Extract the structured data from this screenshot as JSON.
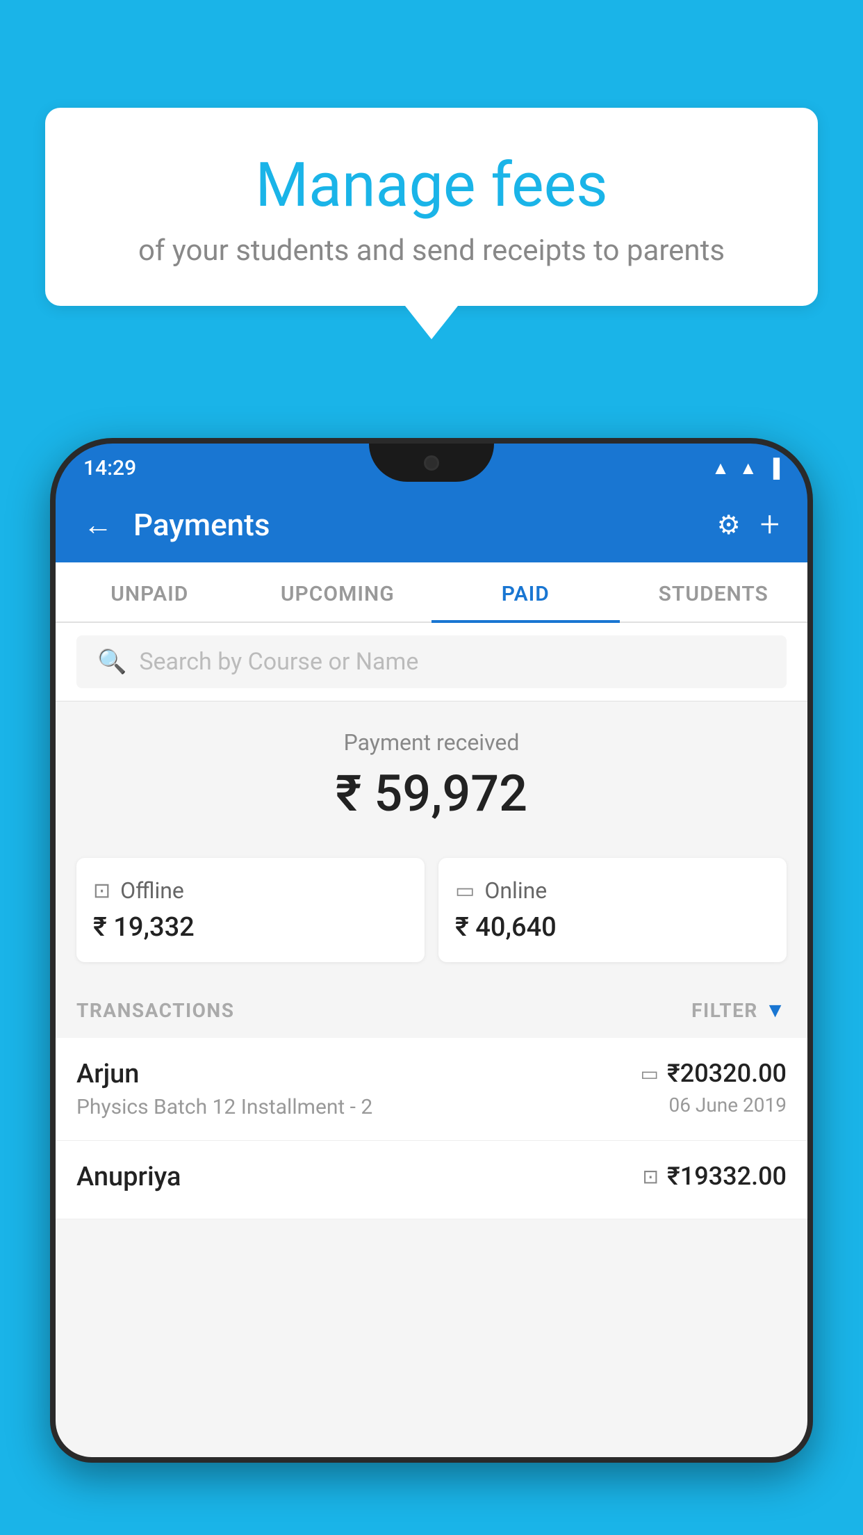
{
  "background_color": "#1ab4e8",
  "bubble": {
    "title": "Manage fees",
    "subtitle": "of your students and send receipts to parents"
  },
  "status_bar": {
    "time": "14:29",
    "icons": [
      "wifi",
      "signal",
      "battery"
    ]
  },
  "header": {
    "title": "Payments",
    "back_label": "←",
    "settings_label": "⚙",
    "add_label": "+"
  },
  "tabs": [
    {
      "label": "UNPAID",
      "active": false
    },
    {
      "label": "UPCOMING",
      "active": false
    },
    {
      "label": "PAID",
      "active": true
    },
    {
      "label": "STUDENTS",
      "active": false
    }
  ],
  "search": {
    "placeholder": "Search by Course or Name"
  },
  "payment_summary": {
    "label": "Payment received",
    "amount": "₹ 59,972",
    "offline": {
      "label": "Offline",
      "amount": "₹ 19,332"
    },
    "online": {
      "label": "Online",
      "amount": "₹ 40,640"
    }
  },
  "transactions": {
    "header_label": "TRANSACTIONS",
    "filter_label": "FILTER",
    "rows": [
      {
        "name": "Arjun",
        "detail": "Physics Batch 12 Installment - 2",
        "amount": "₹20320.00",
        "date": "06 June 2019",
        "payment_type": "card"
      },
      {
        "name": "Anupriya",
        "detail": "",
        "amount": "₹19332.00",
        "date": "",
        "payment_type": "offline"
      }
    ]
  }
}
